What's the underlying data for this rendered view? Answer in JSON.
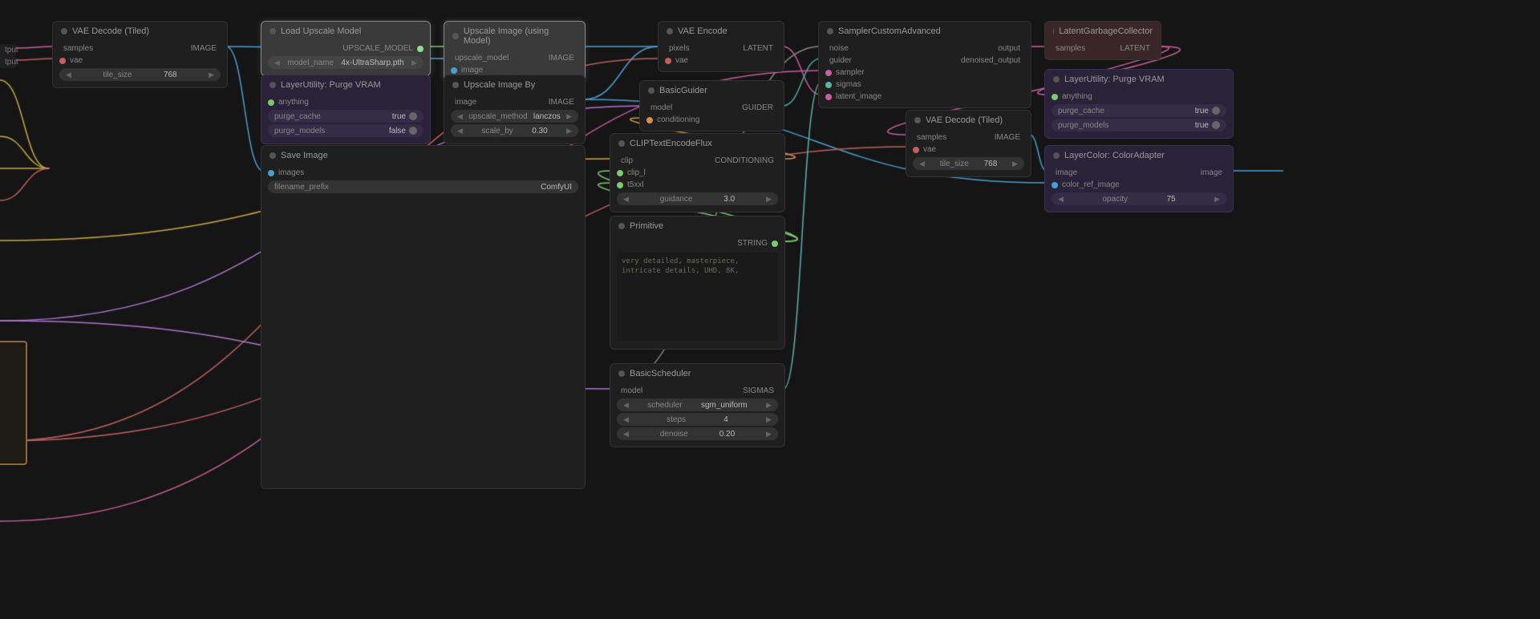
{
  "nodes": {
    "vae_decode_tiled": {
      "title": "VAE Decode (Tiled)",
      "inputs": [
        "samples",
        "vae"
      ],
      "outputs": [
        "IMAGE"
      ],
      "tile_size_label": "tile_size",
      "tile_size_value": "768"
    },
    "load_upscale_model": {
      "title": "Load Upscale Model",
      "outputs": [
        "UPSCALE_MODEL"
      ],
      "model_name_label": "model_name",
      "model_name_value": "4x-UltraSharp.pth"
    },
    "upscale_image_model": {
      "title": "Upscale Image (using Model)",
      "inputs": [
        "upscale_model",
        "image"
      ],
      "outputs": [
        "IMAGE"
      ]
    },
    "purge_vram": {
      "title": "LayerUtility: Purge VRAM",
      "inputs": [
        "anything"
      ],
      "purge_cache_label": "purge_cache",
      "purge_cache_value": "true",
      "purge_models_label": "purge_models",
      "purge_models_value": "false"
    },
    "upscale_image_by": {
      "title": "Upscale Image By",
      "inputs": [
        "image"
      ],
      "outputs": [
        "IMAGE"
      ],
      "upscale_method_label": "upscale_method",
      "upscale_method_value": "lanczos",
      "scale_by_label": "scale_by",
      "scale_by_value": "0.30"
    },
    "save_image": {
      "title": "Save Image",
      "inputs": [
        "images"
      ],
      "filename_prefix_label": "filename_prefix",
      "filename_prefix_value": "ComfyUI"
    },
    "vae_encode": {
      "title": "VAE Encode",
      "inputs": [
        "pixels",
        "vae"
      ],
      "outputs": [
        "LATENT"
      ]
    },
    "basic_guider": {
      "title": "BasicGuider",
      "inputs": [
        "model",
        "conditioning"
      ],
      "outputs": [
        "GUIDER"
      ]
    },
    "clip_encode_flux": {
      "title": "CLIPTextEncodeFlux",
      "inputs": [
        "clip",
        "clip_l",
        "t5xxl"
      ],
      "outputs": [
        "CONDITIONING"
      ],
      "guidance_label": "guidance",
      "guidance_value": "3.0"
    },
    "primitive": {
      "title": "Primitive",
      "outputs": [
        "STRING"
      ],
      "text_value": "very detailed, masterpiece, intricate details, UHD, 8K,"
    },
    "basic_scheduler": {
      "title": "BasicScheduler",
      "inputs": [
        "model"
      ],
      "outputs": [
        "SIGMAS"
      ],
      "scheduler_label": "scheduler",
      "scheduler_value": "sgm_uniform",
      "steps_label": "steps",
      "steps_value": "4",
      "denoise_label": "denoise",
      "denoise_value": "0.20"
    },
    "sampler_custom": {
      "title": "SamplerCustomAdvanced",
      "inputs": [
        "noise",
        "guider",
        "sampler",
        "sigmas",
        "latent_image"
      ],
      "outputs": [
        "output",
        "denoised_output"
      ]
    },
    "latent_gc": {
      "title": "LatentGarbageCollector",
      "inputs": [
        "samples"
      ],
      "outputs": [
        "LATENT"
      ]
    },
    "purge_vram2": {
      "title": "LayerUtility: Purge VRAM",
      "inputs": [
        "anything"
      ],
      "purge_cache_label": "purge_cache",
      "purge_cache_value": "true",
      "purge_models_label": "purge_models",
      "purge_models_value": "true"
    },
    "vae_decode_tiled2": {
      "title": "VAE Decode (Tiled)",
      "inputs": [
        "samples",
        "vae"
      ],
      "outputs": [
        "IMAGE"
      ],
      "tile_size_label": "tile_size",
      "tile_size_value": "768"
    },
    "color_adapter": {
      "title": "LayerColor: ColorAdapter",
      "inputs": [
        "image",
        "color_ref_image"
      ],
      "outputs": [
        "image"
      ],
      "opacity_label": "opacity",
      "opacity_value": "75"
    },
    "fragment1": "tput",
    "fragment2": "tput"
  }
}
